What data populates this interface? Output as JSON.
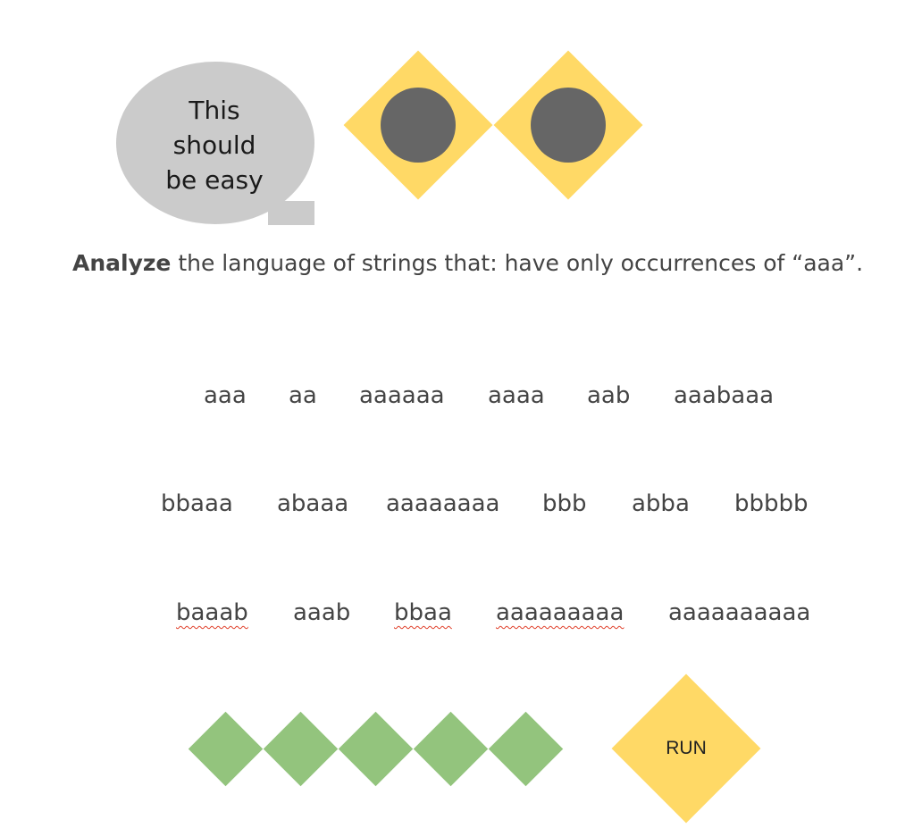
{
  "speech_bubble": {
    "lines": [
      "This",
      "should",
      "be easy"
    ]
  },
  "prompt": {
    "bold": "Analyze",
    "rest": " the language of strings that: have only occurrences of  “aaa”."
  },
  "words": [
    "aaa",
    "aa",
    "aaaaaa",
    "aaaa",
    "aab",
    "aaabaaa",
    "bbaaa",
    "abaaa",
    "aaaaaaaa",
    "bbb",
    "abba",
    "bbbbb",
    "baaab",
    "aaab",
    "bbaa",
    "aaaaaaaaa",
    "aaaaaaaaaa"
  ],
  "answer_slots": 5,
  "run_button": {
    "label": "RUN"
  },
  "colors": {
    "bubble": "#cbcbcb",
    "eye": "#ffd966",
    "pupil": "#666666",
    "slot": "#93c47d",
    "run": "#ffd966",
    "spellcheck": "#e0402a"
  }
}
